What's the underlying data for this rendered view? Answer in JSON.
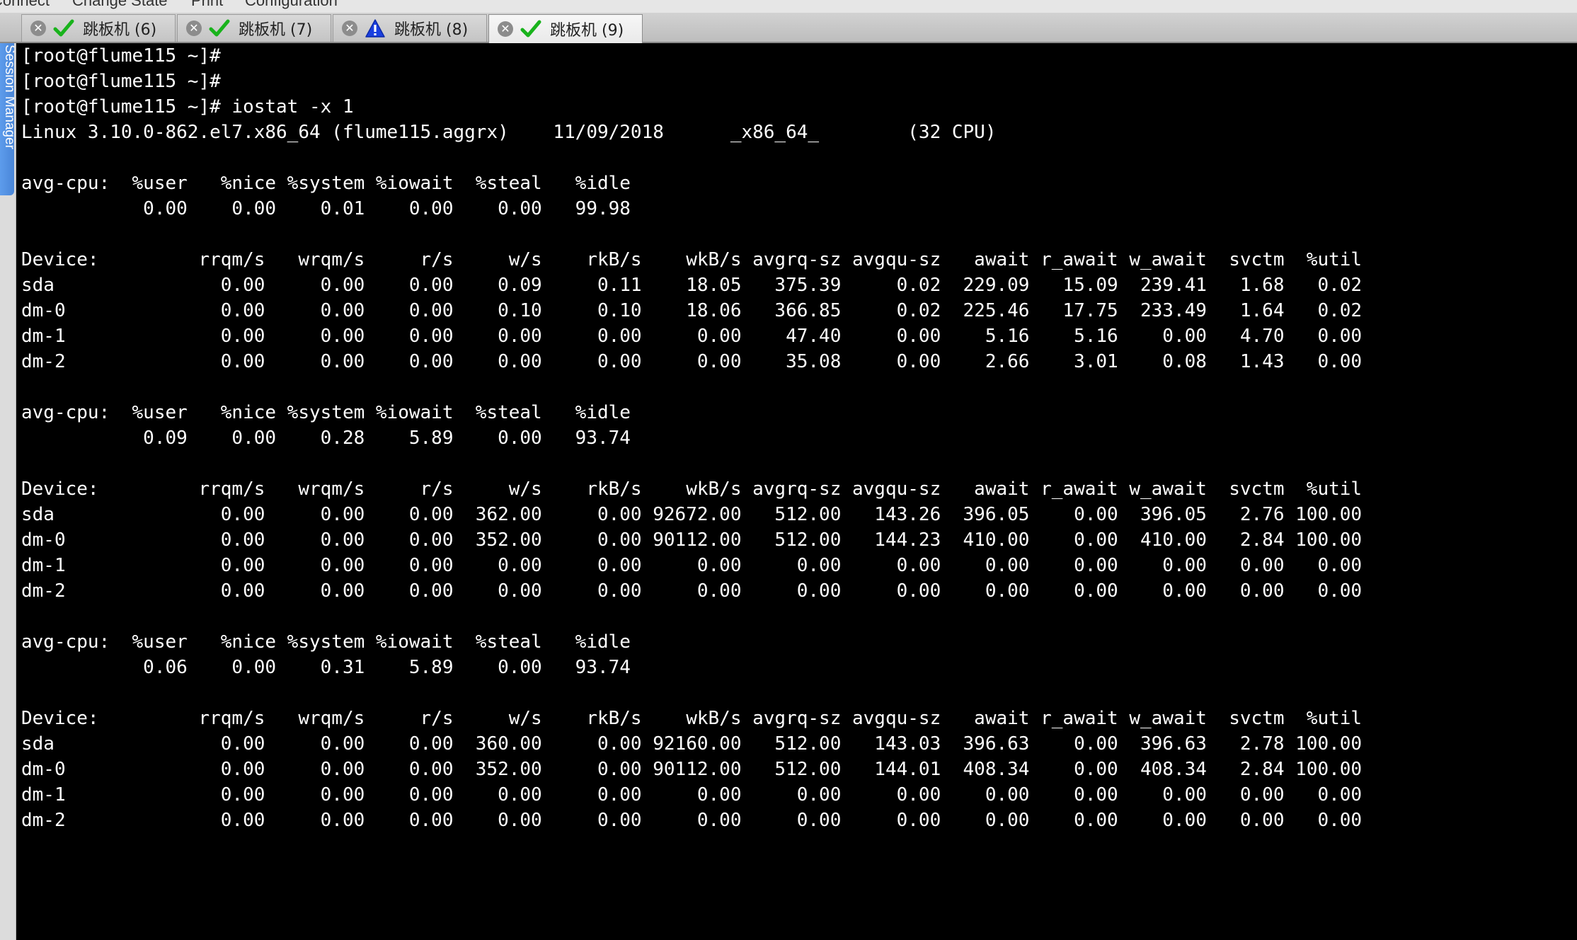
{
  "menubar": {
    "items": [
      "Connect",
      "Change State",
      "Print",
      "Configuration"
    ]
  },
  "tabs": [
    {
      "label": "跳板机 (6)",
      "status": "check-icon",
      "active": false
    },
    {
      "label": "跳板机 (7)",
      "status": "check-icon",
      "active": false
    },
    {
      "label": "跳板机 (8)",
      "status": "warning-icon",
      "active": false
    },
    {
      "label": "跳板机 (9)",
      "status": "check-icon",
      "active": true
    }
  ],
  "sidebar": {
    "session_manager_label": "Session Manager"
  },
  "colors": {
    "terminal_bg": "#000000",
    "terminal_fg": "#ffffff",
    "check": "#19b31c",
    "warning": "#1a3fe0",
    "session_tab": "#4a86d8"
  },
  "terminal": {
    "lines": [
      "[root@flume115 ~]#",
      "[root@flume115 ~]#",
      "[root@flume115 ~]# iostat -x 1",
      "Linux 3.10.0-862.el7.x86_64 (flume115.aggrx)    11/09/2018      _x86_64_        (32 CPU)",
      "",
      "avg-cpu:  %user   %nice %system %iowait  %steal   %idle",
      "           0.00    0.00    0.01    0.00    0.00   99.98",
      "",
      "Device:         rrqm/s   wrqm/s     r/s     w/s    rkB/s    wkB/s avgrq-sz avgqu-sz   await r_await w_await  svctm  %util",
      "sda               0.00     0.00    0.00    0.09     0.11    18.05   375.39     0.02  229.09   15.09  239.41   1.68   0.02",
      "dm-0              0.00     0.00    0.00    0.10     0.10    18.06   366.85     0.02  225.46   17.75  233.49   1.64   0.02",
      "dm-1              0.00     0.00    0.00    0.00     0.00     0.00    47.40     0.00    5.16    5.16    0.00   4.70   0.00",
      "dm-2              0.00     0.00    0.00    0.00     0.00     0.00    35.08     0.00    2.66    3.01    0.08   1.43   0.00",
      "",
      "avg-cpu:  %user   %nice %system %iowait  %steal   %idle",
      "           0.09    0.00    0.28    5.89    0.00   93.74",
      "",
      "Device:         rrqm/s   wrqm/s     r/s     w/s    rkB/s    wkB/s avgrq-sz avgqu-sz   await r_await w_await  svctm  %util",
      "sda               0.00     0.00    0.00  362.00     0.00 92672.00   512.00   143.26  396.05    0.00  396.05   2.76 100.00",
      "dm-0              0.00     0.00    0.00  352.00     0.00 90112.00   512.00   144.23  410.00    0.00  410.00   2.84 100.00",
      "dm-1              0.00     0.00    0.00    0.00     0.00     0.00     0.00     0.00    0.00    0.00    0.00   0.00   0.00",
      "dm-2              0.00     0.00    0.00    0.00     0.00     0.00     0.00     0.00    0.00    0.00    0.00   0.00   0.00",
      "",
      "avg-cpu:  %user   %nice %system %iowait  %steal   %idle",
      "           0.06    0.00    0.31    5.89    0.00   93.74",
      "",
      "Device:         rrqm/s   wrqm/s     r/s     w/s    rkB/s    wkB/s avgrq-sz avgqu-sz   await r_await w_await  svctm  %util",
      "sda               0.00     0.00    0.00  360.00     0.00 92160.00   512.00   143.03  396.63    0.00  396.63   2.78 100.00",
      "dm-0              0.00     0.00    0.00  352.00     0.00 90112.00   512.00   144.01  408.34    0.00  408.34   2.84 100.00",
      "dm-1              0.00     0.00    0.00    0.00     0.00     0.00     0.00     0.00    0.00    0.00    0.00   0.00   0.00",
      "dm-2              0.00     0.00    0.00    0.00     0.00     0.00     0.00     0.00    0.00    0.00    0.00   0.00   0.00"
    ]
  }
}
